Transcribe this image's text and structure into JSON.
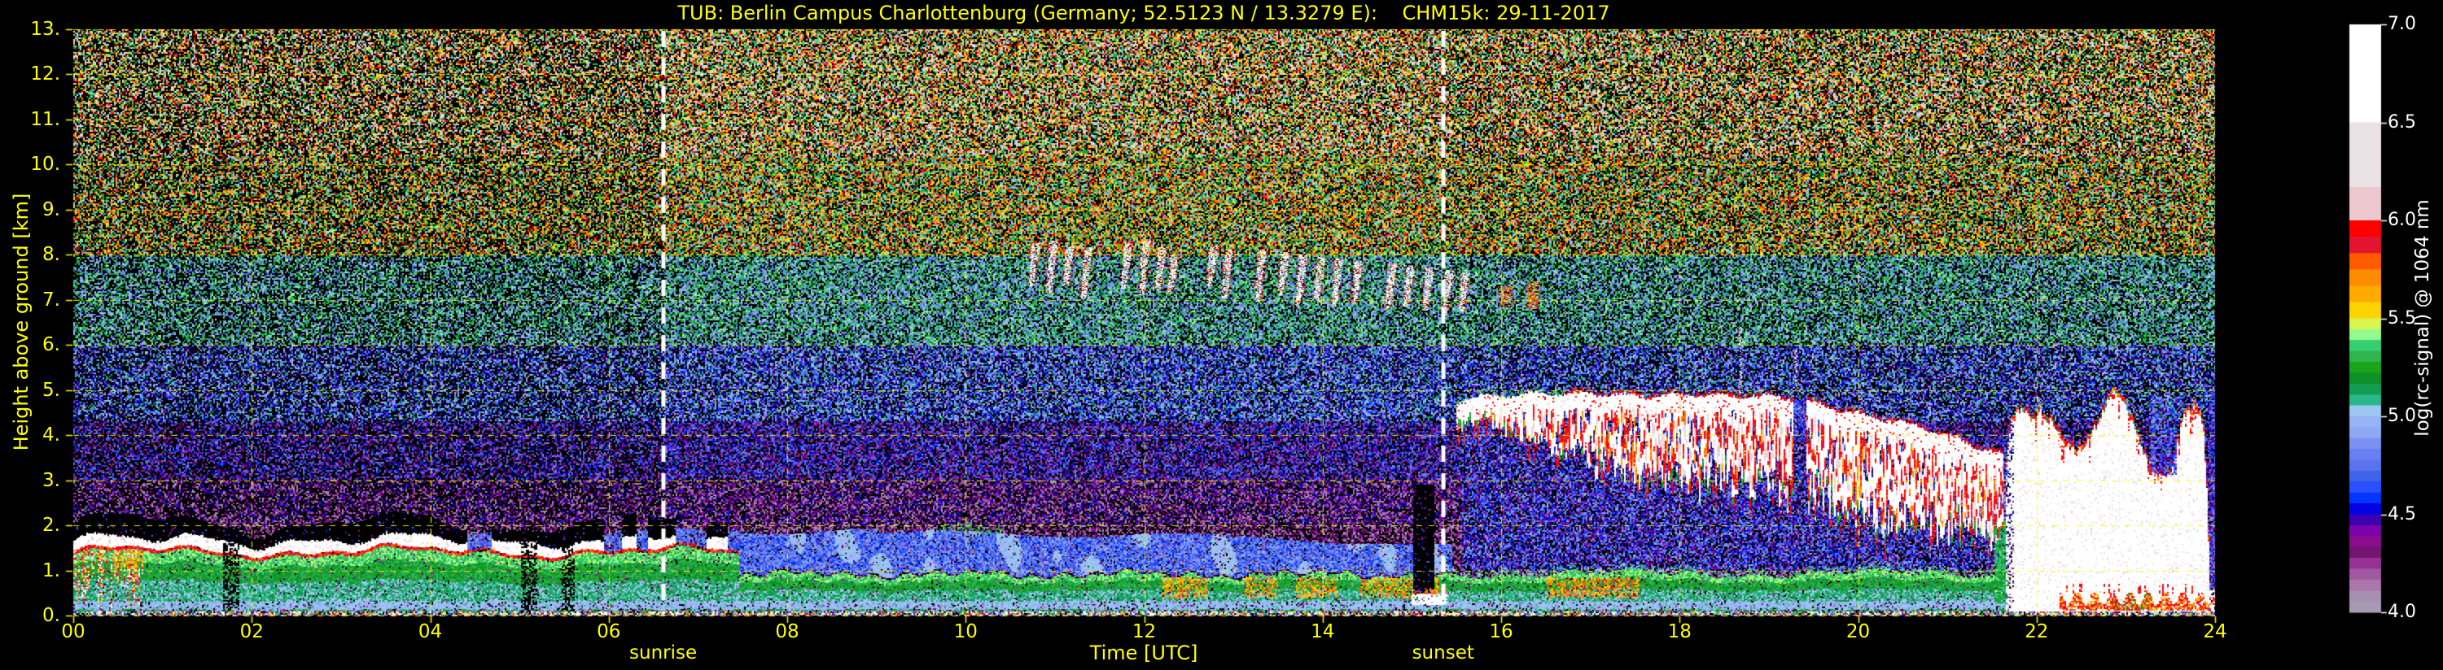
{
  "page": {
    "background": "#000000"
  },
  "chart_data": {
    "type": "heatmap",
    "title": "TUB: Berlin Campus Charlottenburg (Germany; 52.5123 N / 13.3279 E):    CHM15k: 29-11-2017",
    "xlabel": "Time [UTC]",
    "ylabel": "Height above ground [km]",
    "axis_color": "#ffff00",
    "x_range_hours": [
      0,
      24
    ],
    "y_range_km": [
      0,
      13
    ],
    "x_ticks": [
      {
        "v": 0,
        "label": "00"
      },
      {
        "v": 2,
        "label": "02"
      },
      {
        "v": 4,
        "label": "04"
      },
      {
        "v": 6,
        "label": "06"
      },
      {
        "v": 8,
        "label": "08"
      },
      {
        "v": 10,
        "label": "10"
      },
      {
        "v": 12,
        "label": "12"
      },
      {
        "v": 14,
        "label": "14"
      },
      {
        "v": 16,
        "label": "16"
      },
      {
        "v": 18,
        "label": "18"
      },
      {
        "v": 20,
        "label": "20"
      },
      {
        "v": 22,
        "label": "22"
      },
      {
        "v": 24,
        "label": "24"
      }
    ],
    "y_ticks": [
      {
        "v": 0,
        "label": "0."
      },
      {
        "v": 1,
        "label": "1."
      },
      {
        "v": 2,
        "label": "2."
      },
      {
        "v": 3,
        "label": "3."
      },
      {
        "v": 4,
        "label": "4."
      },
      {
        "v": 5,
        "label": "5."
      },
      {
        "v": 6,
        "label": "6."
      },
      {
        "v": 7,
        "label": "7."
      },
      {
        "v": 8,
        "label": "8."
      },
      {
        "v": 9,
        "label": "9."
      },
      {
        "v": 10,
        "label": "10."
      },
      {
        "v": 11,
        "label": "11."
      },
      {
        "v": 12,
        "label": "12."
      },
      {
        "v": 13,
        "label": "13."
      }
    ],
    "grid": {
      "show": true,
      "color": "#ffff00",
      "style": "dashed",
      "x_step_hours": 2,
      "y_step_km": 1
    },
    "events": [
      {
        "label": "sunrise",
        "hour": 6.61,
        "line_color": "#ffffff"
      },
      {
        "label": "sunset",
        "hour": 15.35,
        "line_color": "#ffffff"
      }
    ],
    "colorbar": {
      "label": "log(rc-signal) @ 1064 nm",
      "tick_labels": [
        "7.0",
        "6.5",
        "6.0",
        "5.5",
        "5.0",
        "4.5",
        "4.0"
      ],
      "range": [
        4.0,
        7.0
      ],
      "text_color": "#ffffff",
      "bands": [
        [
          7.0,
          "#ffffff"
        ],
        [
          6.5,
          "#eae3e6"
        ],
        [
          6.17,
          "#edc9cf"
        ],
        [
          6.0,
          "#fe0000"
        ],
        [
          5.917,
          "#e31430"
        ],
        [
          5.833,
          "#fe5a00"
        ],
        [
          5.75,
          "#fe8c00"
        ],
        [
          5.667,
          "#ffaa00"
        ],
        [
          5.583,
          "#ffd300"
        ],
        [
          5.5,
          "#d9f54f"
        ],
        [
          5.444,
          "#93fa90"
        ],
        [
          5.389,
          "#35cf72"
        ],
        [
          5.333,
          "#2fb54d"
        ],
        [
          5.278,
          "#18a51b"
        ],
        [
          5.222,
          "#0f8f28"
        ],
        [
          5.167,
          "#129d52"
        ],
        [
          5.111,
          "#2ab88b"
        ],
        [
          5.056,
          "#9ec7f2"
        ],
        [
          5.0,
          "#98b4f8"
        ],
        [
          4.944,
          "#8da9f3"
        ],
        [
          4.889,
          "#7b90f2"
        ],
        [
          4.833,
          "#687ff3"
        ],
        [
          4.778,
          "#5b74ee"
        ],
        [
          4.722,
          "#3f64ea"
        ],
        [
          4.667,
          "#2950fa"
        ],
        [
          4.611,
          "#0435fe"
        ],
        [
          4.556,
          "#0202e2"
        ],
        [
          4.5,
          "#3c02b0"
        ],
        [
          4.444,
          "#7c02ad"
        ],
        [
          4.389,
          "#8d0b8f"
        ],
        [
          4.333,
          "#73146f"
        ],
        [
          4.278,
          "#953294"
        ],
        [
          4.222,
          "#a058a0"
        ],
        [
          4.167,
          "#aa77ab"
        ],
        [
          4.111,
          "#a78fb2"
        ],
        [
          4.056,
          "#a79ab5"
        ]
      ]
    },
    "features": {
      "background_noise_height_bands": [
        {
          "h": [
            10.2,
            13
          ],
          "v": [
            4.95,
            6.3
          ]
        },
        {
          "h": [
            8,
            10.2
          ],
          "v": [
            4.9,
            5.95
          ]
        },
        {
          "h": [
            6,
            8
          ],
          "v": [
            4.7,
            5.45
          ]
        },
        {
          "h": [
            4.3,
            6
          ],
          "v": [
            4.4,
            5.15
          ]
        },
        {
          "h": [
            3,
            4.3
          ],
          "v": [
            4.2,
            4.85
          ]
        },
        {
          "h": [
            2,
            3
          ],
          "v": [
            4.03,
            4.57
          ]
        },
        {
          "h": [
            0,
            2
          ],
          "v": [
            4.02,
            4.45
          ]
        }
      ],
      "boundary_layer": {
        "t": [
          0,
          21.68
        ],
        "top_km_night": 1.5,
        "top_km_day": 0.95
      },
      "morning_cloud": {
        "t": [
          0,
          7.45
        ],
        "base_km": 1.55,
        "top_km": 1.85,
        "solid_until_hour": 4.3
      },
      "drizzle": {
        "t": [
          0,
          0.78
        ],
        "below_km": 1.5
      },
      "day_blue_layer": {
        "t": [
          7.45,
          15.45
        ],
        "top_km": 1.8
      },
      "aerosol_hotspots": [
        {
          "t": [
            12.2,
            12.7
          ]
        },
        {
          "t": [
            13.1,
            13.5
          ]
        },
        {
          "t": [
            13.7,
            14.15
          ]
        },
        {
          "t": [
            14.4,
            15.3
          ]
        },
        {
          "t": [
            16.5,
            17.55
          ],
          "strong": true
        }
      ],
      "dark_columns": [
        [
          1.68,
          1.86
        ],
        [
          5.02,
          5.2
        ],
        [
          5.48,
          5.62
        ]
      ],
      "attenuation_gap": {
        "t": [
          15.02,
          15.24
        ],
        "h": [
          0.45,
          2.9
        ]
      },
      "virga_streaks": [
        [
          10.78,
          8.25,
          7.3
        ],
        [
          10.98,
          8.3,
          7.15
        ],
        [
          11.17,
          8.2,
          7.3
        ],
        [
          11.37,
          8.15,
          7.0
        ],
        [
          11.82,
          8.25,
          7.25
        ],
        [
          12.02,
          8.3,
          7.1
        ],
        [
          12.2,
          8.15,
          7.2
        ],
        [
          12.34,
          8.0,
          7.15
        ],
        [
          12.78,
          8.2,
          7.3
        ],
        [
          12.95,
          8.1,
          7.05
        ],
        [
          13.32,
          8.1,
          6.95
        ],
        [
          13.58,
          8.05,
          7.1
        ],
        [
          13.78,
          8.0,
          6.9
        ],
        [
          13.98,
          7.95,
          7.0
        ],
        [
          14.18,
          7.9,
          6.85
        ],
        [
          14.4,
          7.85,
          6.9
        ],
        [
          14.78,
          7.8,
          6.8
        ],
        [
          14.98,
          7.75,
          6.85
        ],
        [
          15.2,
          7.7,
          6.75
        ],
        [
          15.42,
          7.65,
          6.7
        ],
        [
          15.6,
          7.6,
          6.75
        ]
      ],
      "red_clusters": [
        [
          16.05,
          7.3,
          6.85
        ],
        [
          16.35,
          7.4,
          6.8
        ]
      ],
      "thin_streaks": [
        [
          18.68,
          6.4,
          4.9
        ],
        [
          19.3,
          5.9,
          4.85
        ],
        [
          22.95,
          9.9,
          8.8
        ]
      ],
      "cloud_deck": {
        "t": [
          15.5,
          21.62
        ],
        "top_km": [
          [
            15.5,
            4.7
          ],
          [
            15.6,
            4.82
          ],
          [
            16.2,
            4.9
          ],
          [
            17.0,
            4.92
          ],
          [
            17.6,
            4.87
          ],
          [
            18.2,
            4.9
          ],
          [
            18.8,
            4.86
          ],
          [
            19.3,
            4.82
          ],
          [
            19.6,
            4.65
          ],
          [
            19.9,
            4.5
          ],
          [
            20.2,
            4.38
          ],
          [
            20.5,
            4.28
          ],
          [
            20.8,
            4.12
          ],
          [
            21.1,
            3.92
          ],
          [
            21.35,
            3.72
          ],
          [
            21.62,
            3.55
          ]
        ],
        "virga_depth_km": [
          [
            15.5,
            0.45
          ],
          [
            16.1,
            0.8
          ],
          [
            16.5,
            1.1
          ],
          [
            17.0,
            1.5
          ],
          [
            18.0,
            1.9
          ],
          [
            19.0,
            2.05
          ],
          [
            20.0,
            2.2
          ],
          [
            20.6,
            2.1
          ],
          [
            21.0,
            2.0
          ],
          [
            21.62,
            1.85
          ]
        ],
        "gap_t": [
          19.27,
          19.42
        ]
      },
      "precipitation": {
        "t": [
          21.66,
          23.93
        ],
        "top_km": [
          [
            21.66,
            3.4
          ],
          [
            21.72,
            4.4
          ],
          [
            21.85,
            4.55
          ],
          [
            21.95,
            4.35
          ],
          [
            22.05,
            4.5
          ],
          [
            22.2,
            4.2
          ],
          [
            22.32,
            3.85
          ],
          [
            22.45,
            3.65
          ],
          [
            22.58,
            3.85
          ],
          [
            22.72,
            4.45
          ],
          [
            22.85,
            5.0
          ],
          [
            22.95,
            4.75
          ],
          [
            23.05,
            4.45
          ],
          [
            23.15,
            3.9
          ],
          [
            23.25,
            3.3
          ],
          [
            23.3,
            3.12
          ],
          [
            23.5,
            3.12
          ],
          [
            23.56,
            3.6
          ],
          [
            23.62,
            4.3
          ],
          [
            23.68,
            4.62
          ],
          [
            23.78,
            4.55
          ],
          [
            23.86,
            4.3
          ],
          [
            23.9,
            3.0
          ],
          [
            23.93,
            1.2
          ]
        ],
        "bottom_km": 0.06,
        "fringe": {
          "t": [
            22.25,
            23.9
          ],
          "h": [
            0.16,
            0.5
          ]
        },
        "notch_t": [
          23.28,
          23.56
        ]
      },
      "purple_blob": {
        "t": [
          21.2,
          21.66
        ],
        "h": [
          1.9,
          3.3
        ]
      },
      "green_streak": {
        "t": [
          21.53,
          21.64
        ],
        "h": [
          0.3,
          2.1
        ]
      }
    }
  }
}
